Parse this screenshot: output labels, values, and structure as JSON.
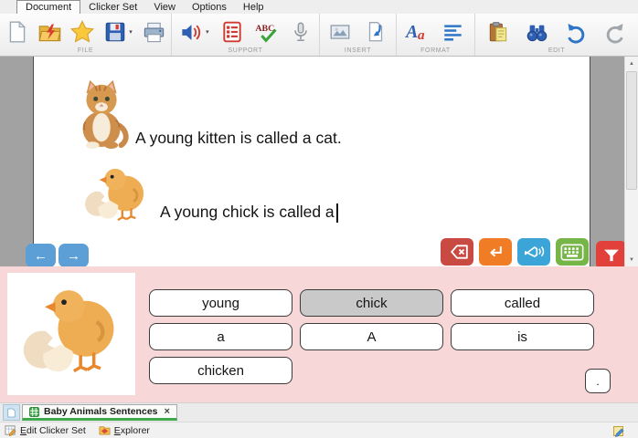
{
  "menu": {
    "items": [
      "Document",
      "Clicker Set",
      "View",
      "Options",
      "Help"
    ],
    "active_item": "Document"
  },
  "toolbar": {
    "groups": [
      {
        "label": "FILE",
        "buttons": [
          {
            "name": "new-document"
          },
          {
            "name": "quick-open"
          },
          {
            "name": "favorites"
          },
          {
            "name": "save",
            "has_dropdown": true
          },
          {
            "name": "print"
          }
        ]
      },
      {
        "label": "SUPPORT",
        "buttons": [
          {
            "name": "speak",
            "has_dropdown": true
          },
          {
            "name": "word-list"
          },
          {
            "name": "check-spelling"
          },
          {
            "name": "record"
          }
        ]
      },
      {
        "label": "INSERT",
        "buttons": [
          {
            "name": "insert-picture"
          },
          {
            "name": "insert-file"
          }
        ]
      },
      {
        "label": "FORMAT",
        "buttons": [
          {
            "name": "font"
          },
          {
            "name": "paragraph-alignment"
          }
        ]
      },
      {
        "label": "EDIT",
        "buttons": [
          {
            "name": "paste"
          },
          {
            "name": "find"
          },
          {
            "name": "undo"
          },
          {
            "name": "redo"
          }
        ]
      }
    ],
    "spellcheck_icon_text": "ABC"
  },
  "document": {
    "sentences": [
      {
        "image": "kitten",
        "text": "A young kitten is called a cat."
      },
      {
        "image": "chick-hatching",
        "text": "A young chick is called a",
        "has_cursor": true
      }
    ]
  },
  "grid": {
    "image_cell": "chick-hatching-picture",
    "cells": [
      {
        "label": "young",
        "selected": false
      },
      {
        "label": "chick",
        "selected": true
      },
      {
        "label": "called",
        "selected": false
      },
      {
        "label": "a",
        "selected": false
      },
      {
        "label": "A",
        "selected": false
      },
      {
        "label": "is",
        "selected": false
      },
      {
        "label": "chicken",
        "selected": false
      }
    ],
    "punctuation": "."
  },
  "tabs": {
    "active": {
      "label": "Baby Animals Sentences",
      "close_glyph": "×"
    }
  },
  "statusbar": {
    "edit_clicker_set": {
      "accel": "E",
      "rest": "dit Clicker Set"
    },
    "explorer": {
      "accel": "E",
      "rest": "xplorer"
    }
  },
  "icons": {
    "back": "←",
    "forward": "→",
    "caret_down": "▾",
    "scroll_up": "▲",
    "scroll_down": "▼"
  },
  "colors": {
    "grid_background": "#f8d7d8",
    "selected_cell": "#c9c9c9",
    "nav_blue": "#5b9fd6",
    "backspace_red": "#c94a43",
    "return_orange": "#f07d26",
    "speak_blue": "#3aa5d6",
    "keyboard_green": "#76b648",
    "popdown_red": "#e2403b",
    "active_tab_green": "#3faa4c"
  }
}
